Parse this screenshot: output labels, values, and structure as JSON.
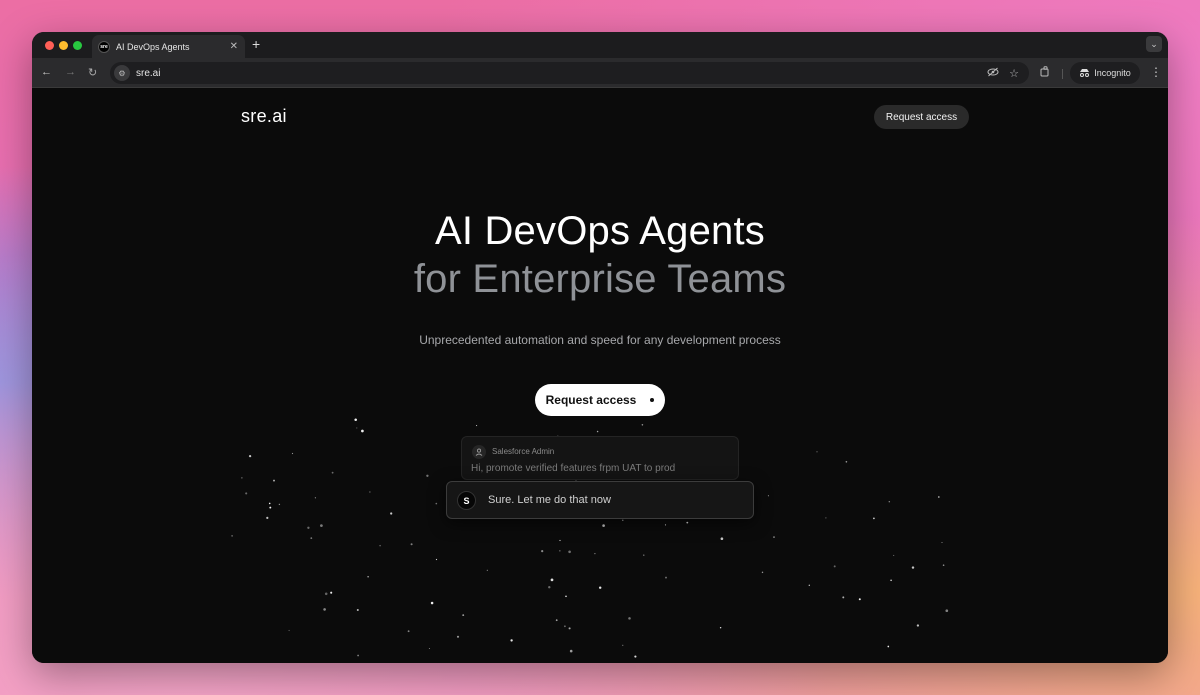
{
  "browser": {
    "tab_title": "AI DevOps Agents",
    "favicon_text": "sre",
    "new_tab": "+",
    "url": "sre.ai",
    "incognito_label": "Incognito"
  },
  "page": {
    "logo": "sre.ai",
    "header_cta": "Request access",
    "hero_line1": "AI DevOps Agents",
    "hero_line2": "for Enterprise Teams",
    "subtitle": "Unprecedented automation and speed for any development process",
    "main_cta": "Request access",
    "chat": {
      "sender": "Salesforce Admin",
      "message": "Hi, promote verified features frpm UAT to prod",
      "reply_avatar": "S",
      "reply": "Sure. Let me do that now"
    }
  },
  "colors": {
    "background": "#0b0b0b",
    "hero_primary": "#ffffff",
    "hero_secondary": "#8f9297"
  },
  "icons": [
    "back-arrow-icon",
    "forward-arrow-icon",
    "reload-icon",
    "site-settings-icon",
    "eye-off-icon",
    "star-icon",
    "extensions-icon",
    "incognito-icon",
    "more-menu-icon",
    "user-icon"
  ]
}
